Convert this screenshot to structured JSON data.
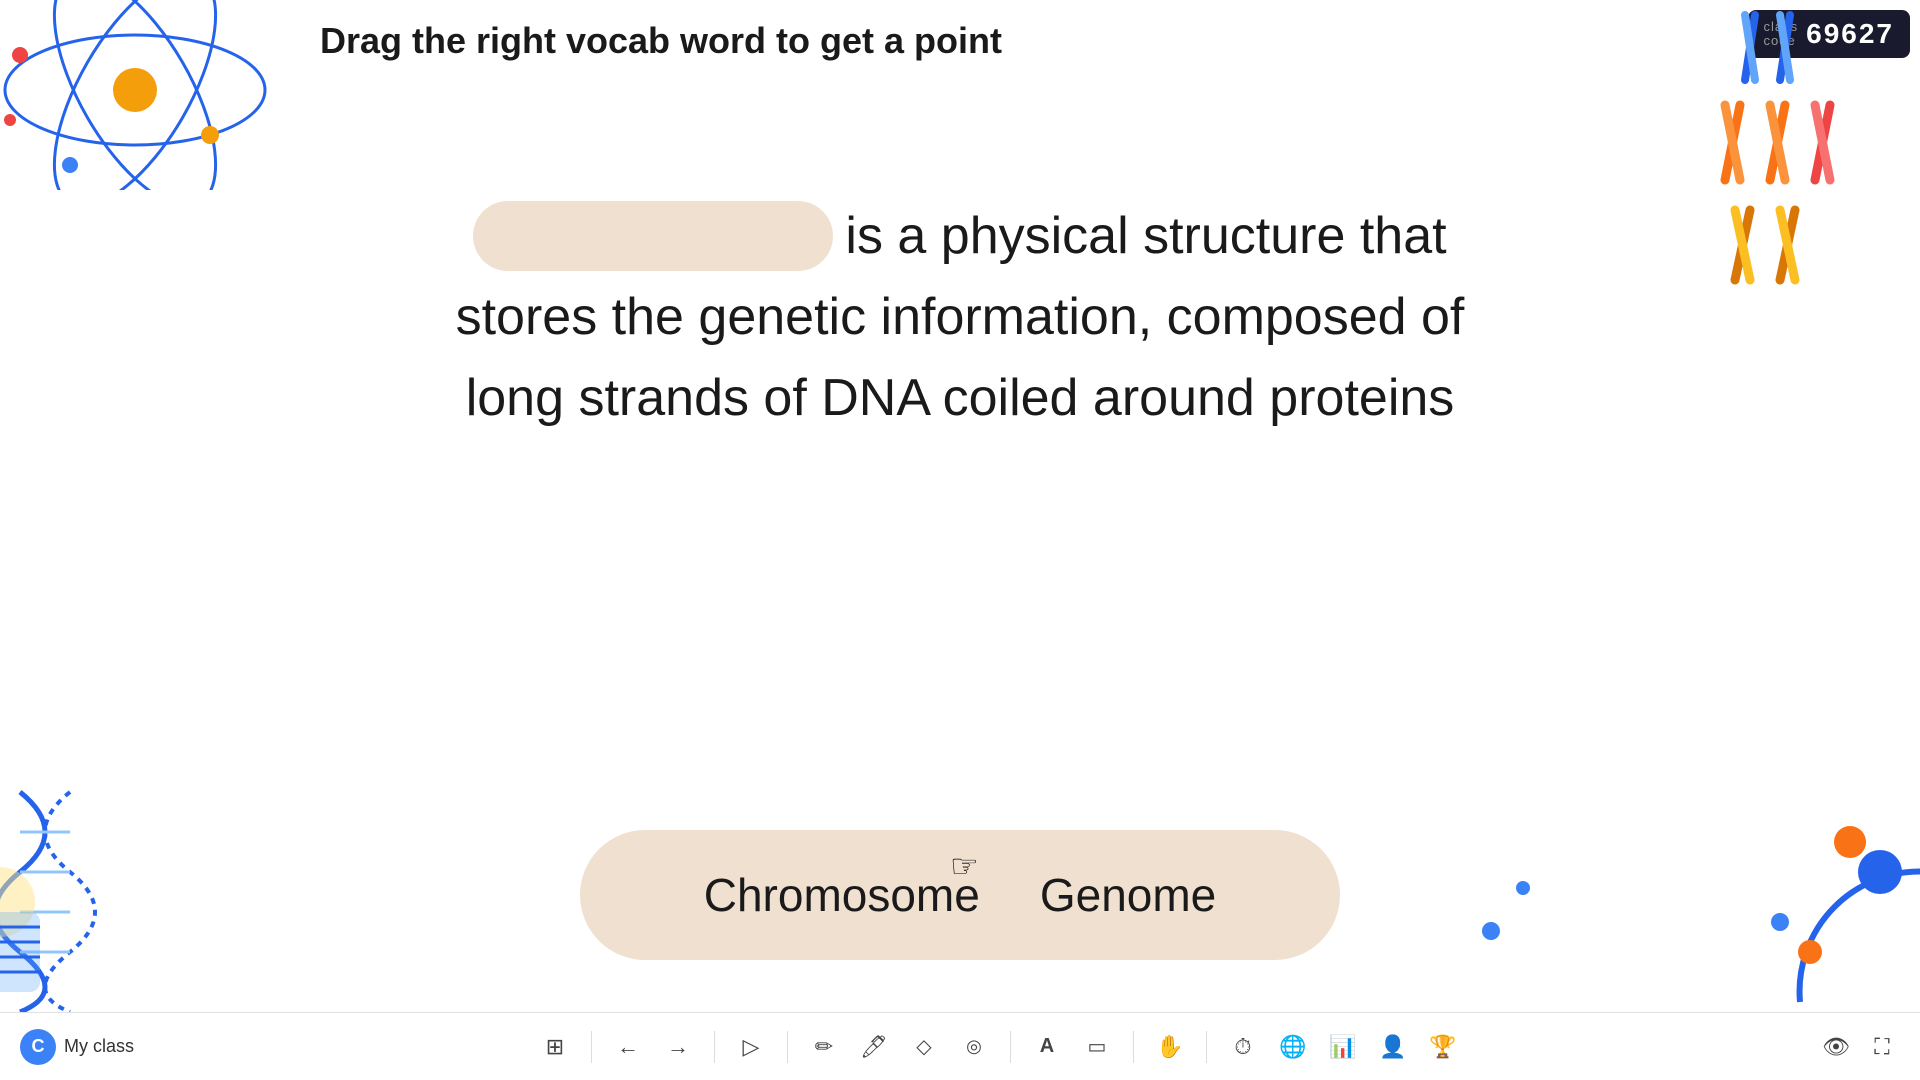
{
  "instruction": "Drag the right vocab word to get a point",
  "class_code": {
    "label": "class\ncode",
    "value": "69627"
  },
  "definition": {
    "blank_placeholder": "",
    "line1": " is a physical structure that",
    "line2": "stores the genetic information, composed of",
    "line3": "long strands of DNA coiled around proteins"
  },
  "vocab_words": [
    {
      "label": "Chromosome"
    },
    {
      "label": "Genome"
    }
  ],
  "toolbar": {
    "my_class_initial": "C",
    "my_class_label": "My class",
    "tools": [
      {
        "name": "grid",
        "icon": "⊞"
      },
      {
        "name": "back",
        "icon": "←"
      },
      {
        "name": "forward",
        "icon": "→"
      },
      {
        "name": "play",
        "icon": "▷"
      },
      {
        "name": "pen",
        "icon": "✏"
      },
      {
        "name": "highlighter",
        "icon": "🖊"
      },
      {
        "name": "eraser",
        "icon": "◇"
      },
      {
        "name": "laser",
        "icon": "◎"
      },
      {
        "name": "text",
        "icon": "A"
      },
      {
        "name": "shapes",
        "icon": "▭"
      },
      {
        "name": "hand",
        "icon": "✋"
      },
      {
        "name": "timer",
        "icon": "⏱"
      },
      {
        "name": "globe",
        "icon": "🌐"
      },
      {
        "name": "chart",
        "icon": "📊"
      },
      {
        "name": "person",
        "icon": "👤"
      },
      {
        "name": "trophy",
        "icon": "🏆"
      }
    ],
    "right_tools": [
      {
        "name": "eye",
        "icon": "👁"
      },
      {
        "name": "expand",
        "icon": "⛶"
      }
    ]
  },
  "colors": {
    "blank_oval": "#f0e0d0",
    "word_bank_bg": "#f0e0d0",
    "badge_bg": "#1a1a2e",
    "accent_blue": "#3b82f6"
  }
}
